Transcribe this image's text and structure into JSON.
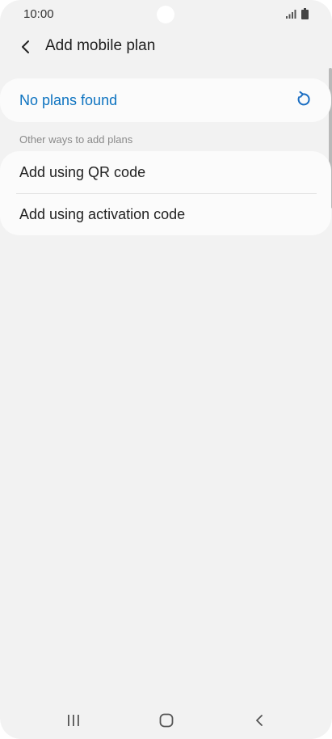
{
  "status_bar": {
    "time": "10:00",
    "icons": [
      "signal-icon",
      "battery-icon"
    ]
  },
  "header": {
    "back_icon": "back-arrow-icon",
    "title": "Add mobile plan"
  },
  "plans": {
    "status_text": "No plans found",
    "refresh_icon": "refresh-icon",
    "accent_color": "#0d73c0"
  },
  "other_ways": {
    "section_title": "Other ways to add plans",
    "options": [
      {
        "label": "Add using QR code"
      },
      {
        "label": "Add using activation code"
      }
    ]
  },
  "nav_bar": {
    "icons": [
      "recents-icon",
      "home-icon",
      "back-icon"
    ]
  }
}
